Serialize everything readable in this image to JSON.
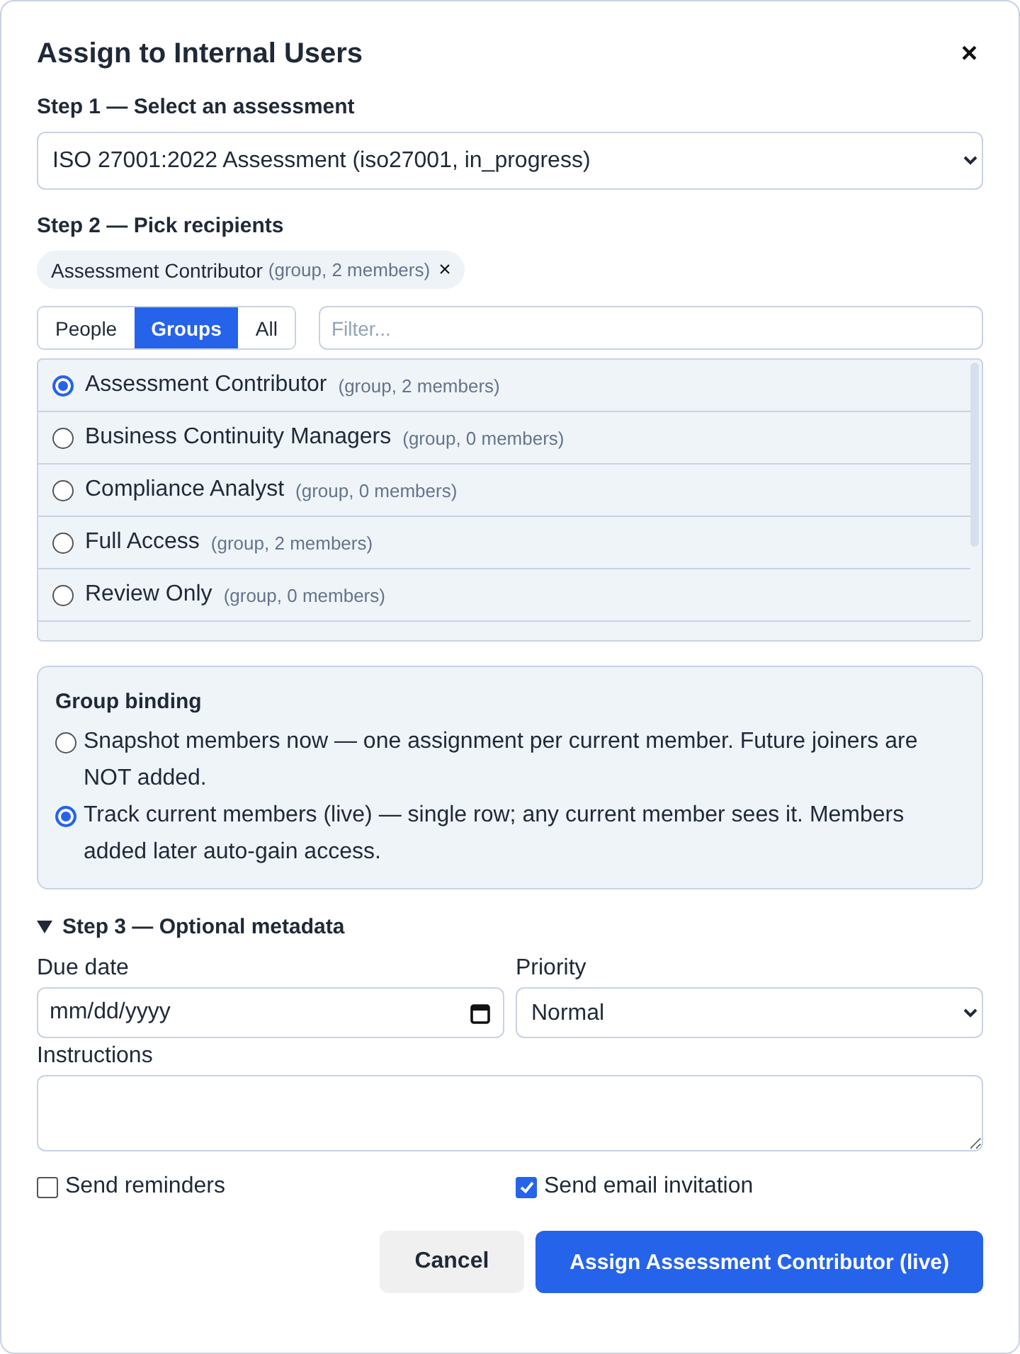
{
  "dialog": {
    "title": "Assign to Internal Users",
    "close": "×"
  },
  "step1": {
    "label": "Step 1 — Select an assessment",
    "value": "ISO 27001:2022 Assessment (iso27001, in_progress)"
  },
  "step2": {
    "label": "Step 2 — Pick recipients",
    "chips": [
      {
        "name": "Assessment Contributor",
        "meta": "(group, 2 members)",
        "remove": "×"
      }
    ],
    "tabs": [
      {
        "label": "People",
        "selected": false
      },
      {
        "label": "Groups",
        "selected": true
      },
      {
        "label": "All",
        "selected": false
      }
    ],
    "filter": {
      "placeholder": "Filter..."
    },
    "options": [
      {
        "name": "Assessment Contributor",
        "meta": "(group, 2 members)",
        "selected": true
      },
      {
        "name": "Business Continuity Managers",
        "meta": "(group, 0 members)",
        "selected": false
      },
      {
        "name": "Compliance Analyst",
        "meta": "(group, 0 members)",
        "selected": false
      },
      {
        "name": "Full Access",
        "meta": "(group, 2 members)",
        "selected": false
      },
      {
        "name": "Review Only",
        "meta": "(group, 0 members)",
        "selected": false
      }
    ]
  },
  "group_binding": {
    "title": "Group binding",
    "options": [
      {
        "label": "Snapshot members now — one assignment per current member. Future joiners are NOT added.",
        "selected": false
      },
      {
        "label": "Track current members (live) — single row; any current member sees it. Members added later auto-gain access.",
        "selected": true
      }
    ]
  },
  "step3": {
    "label": "Step 3 — Optional metadata",
    "expanded": true,
    "due_date": {
      "label": "Due date",
      "placeholder": "mm/dd/yyyy"
    },
    "priority": {
      "label": "Priority",
      "value": "Normal"
    },
    "instructions": {
      "label": "Instructions"
    },
    "checkboxes": [
      {
        "label": "Send reminders",
        "checked": false
      },
      {
        "label": "Send email invitation",
        "checked": true
      }
    ]
  },
  "buttons": [
    {
      "label": "Cancel",
      "kind": "secondary"
    },
    {
      "label": "Assign Assessment Contributor (live)",
      "kind": "primary"
    }
  ]
}
